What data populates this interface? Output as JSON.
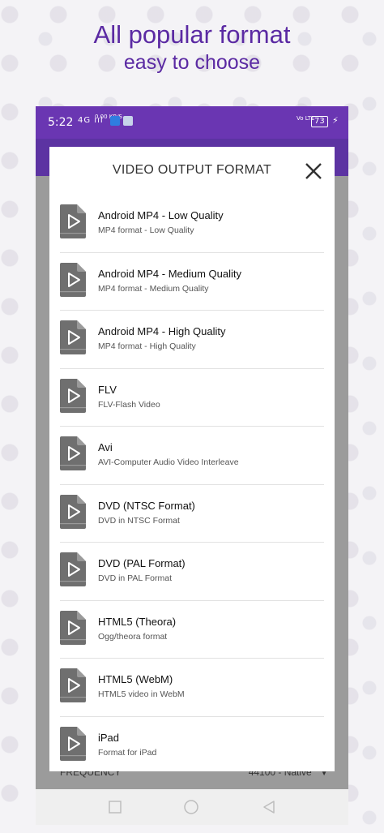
{
  "promo": {
    "line1": "All popular format",
    "line2": "easy to choose"
  },
  "statusbar": {
    "time": "5:22",
    "signal": "4G ııl",
    "net_speed": "0.00 KB/S",
    "volte": "Vo LTE",
    "battery": "73",
    "colors": {
      "background": "#6a36b2"
    }
  },
  "background_row": {
    "label": "FREQUENCY",
    "value": "44100 - Native",
    "arrow": "▼"
  },
  "dialog": {
    "title": "VIDEO OUTPUT FORMAT",
    "close_icon": "close-icon",
    "items": [
      {
        "name": "Android MP4 - Low Quality",
        "desc": "MP4 format - Low Quality",
        "icon": "video-file-icon"
      },
      {
        "name": "Android MP4 - Medium Quality",
        "desc": "MP4 format - Medium Quality",
        "icon": "video-file-icon"
      },
      {
        "name": "Android MP4 - High Quality",
        "desc": "MP4 format - High Quality",
        "icon": "video-file-icon"
      },
      {
        "name": "FLV",
        "desc": "FLV-Flash Video",
        "icon": "video-file-icon"
      },
      {
        "name": "Avi",
        "desc": "AVI-Computer Audio Video Interleave",
        "icon": "video-file-icon"
      },
      {
        "name": "DVD (NTSC Format)",
        "desc": "DVD in NTSC Format",
        "icon": "video-file-icon"
      },
      {
        "name": "DVD (PAL Format)",
        "desc": "DVD in PAL Format",
        "icon": "video-file-icon"
      },
      {
        "name": "HTML5 (Theora)",
        "desc": "Ogg/theora format",
        "icon": "video-file-icon"
      },
      {
        "name": "HTML5 (WebM)",
        "desc": "HTML5 video in WebM",
        "icon": "video-file-icon"
      },
      {
        "name": "iPad",
        "desc": "Format for iPad",
        "icon": "video-file-icon"
      }
    ]
  },
  "navbar": {
    "recent_icon": "square-icon",
    "home_icon": "circle-icon",
    "back_icon": "triangle-back-icon"
  },
  "colors": {
    "brand": "#5b2aa3",
    "appbar": "#5c33a2",
    "file_icon": "#6f6f6f"
  }
}
